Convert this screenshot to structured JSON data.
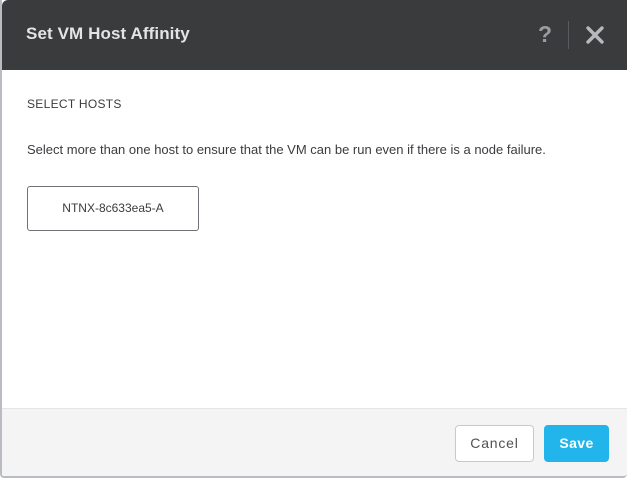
{
  "dialog": {
    "title": "Set VM Host Affinity",
    "help_glyph": "?",
    "help_icon": "question-mark-icon",
    "close_icon": "close-x-icon"
  },
  "body": {
    "section_title": "SELECT HOSTS",
    "instructions": "Select more than one host to ensure that the VM can be run even if there is a node failure.",
    "hosts": [
      {
        "label": "NTNX-8c633ea5-A",
        "selected": false
      }
    ]
  },
  "footer": {
    "cancel_label": "Cancel",
    "save_label": "Save"
  },
  "colors": {
    "header_bg": "#3a3b3d",
    "accent": "#22b5ec",
    "footer_bg": "#f4f4f5"
  }
}
